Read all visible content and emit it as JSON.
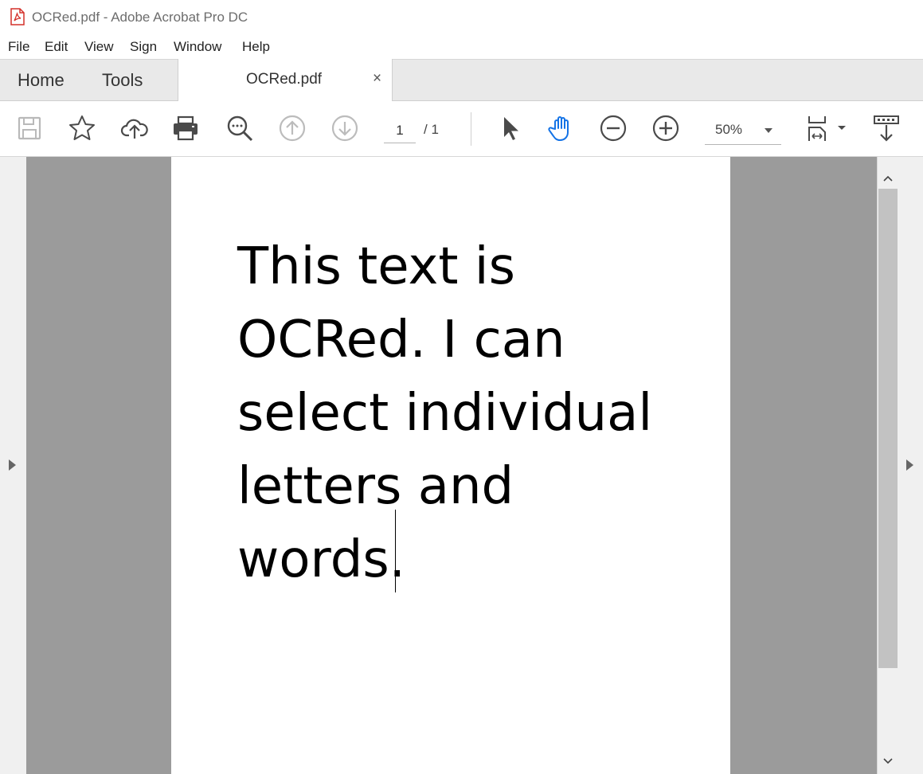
{
  "window": {
    "title": "OCRed.pdf - Adobe Acrobat Pro DC"
  },
  "menu": {
    "file": "File",
    "edit": "Edit",
    "view": "View",
    "sign": "Sign",
    "window": "Window",
    "help": "Help"
  },
  "tabs": {
    "home": "Home",
    "tools": "Tools",
    "document": "OCRed.pdf",
    "close": "×"
  },
  "toolbar": {
    "page_current": "1",
    "page_total": "/ 1",
    "zoom": "50%",
    "icons": [
      "save-icon",
      "bookmark-star-icon",
      "upload-cloud-icon",
      "print-icon",
      "search-zoom-icon",
      "previous-page-icon",
      "next-page-icon",
      "select-arrow-icon",
      "hand-tool-icon",
      "zoom-out-icon",
      "zoom-in-icon",
      "page-display-icon",
      "scroll-mode-icon"
    ],
    "active_tool": "hand-tool",
    "accent_color": "#1473e6"
  },
  "document": {
    "text": "This text is OCRed. I can select individual letters and words."
  }
}
